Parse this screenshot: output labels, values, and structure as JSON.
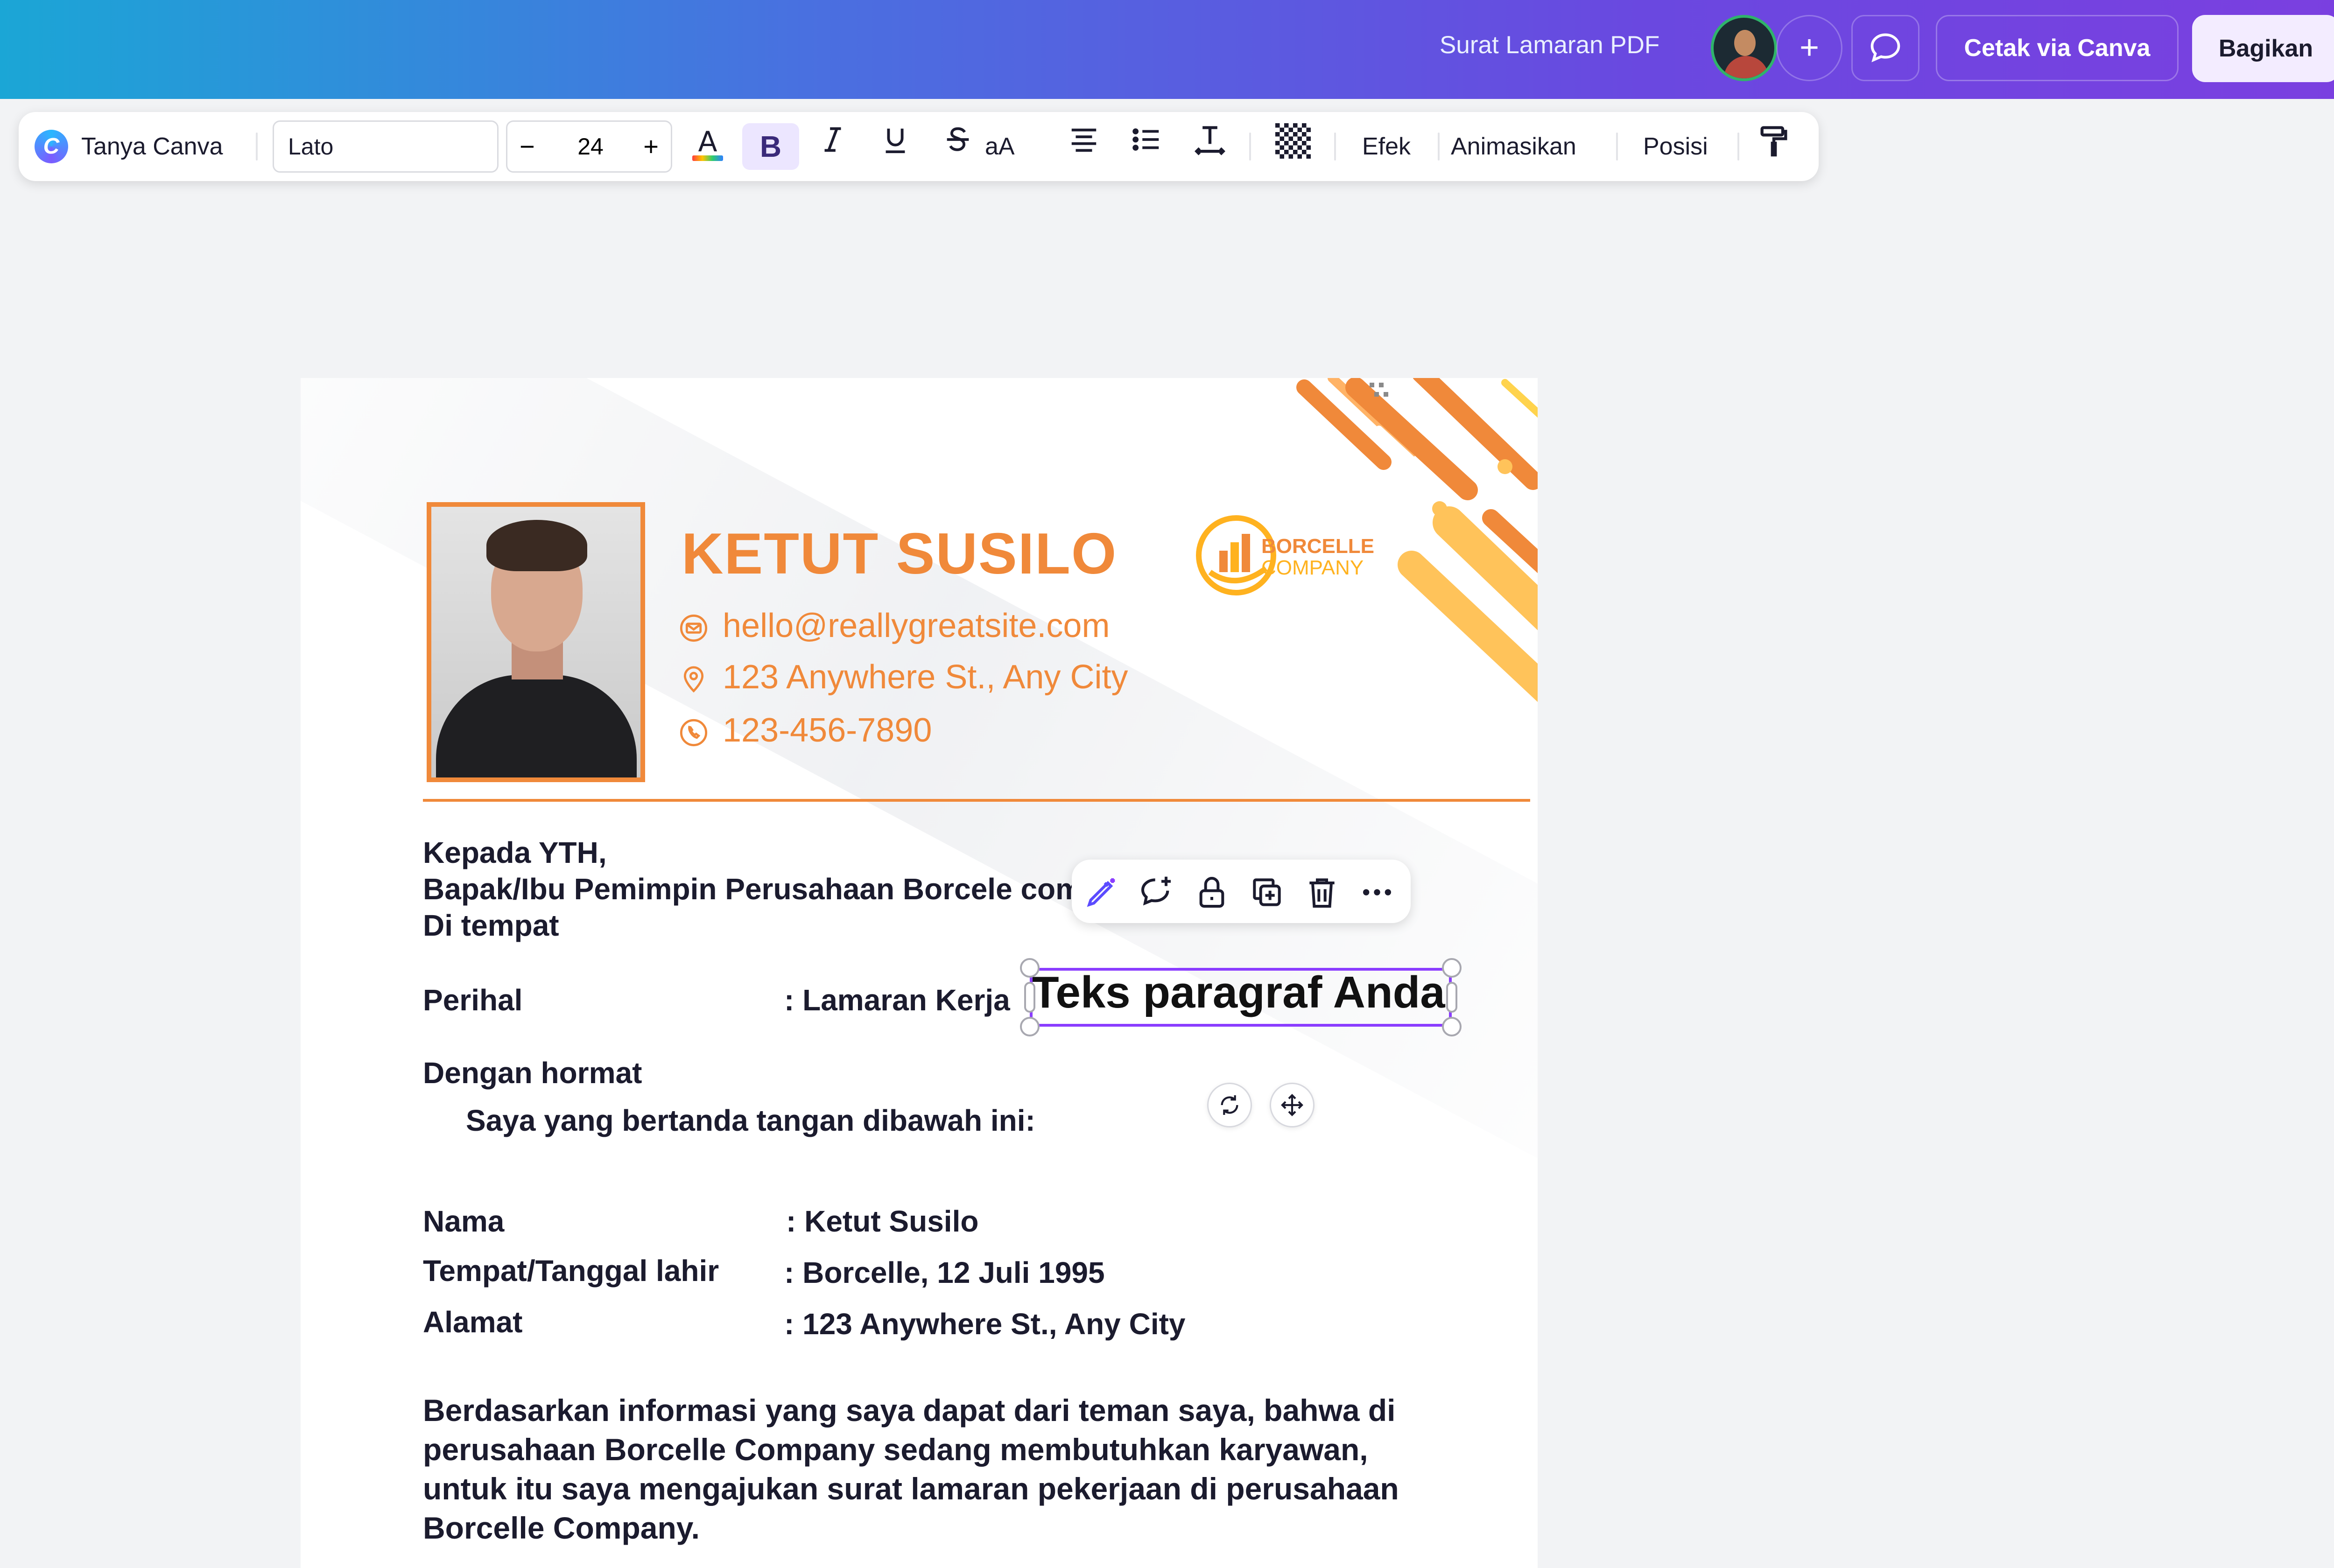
{
  "header": {
    "document_title": "Surat Lamaran PDF",
    "add_label": "+",
    "print_label": "Cetak via Canva",
    "share_label": "Bagikan"
  },
  "toolbar": {
    "assistant_label": "Tanya Canva",
    "font_name": "Lato",
    "font_size": "24",
    "decrease_label": "−",
    "increase_label": "+",
    "bold_label": "B",
    "case_label": "aA",
    "effects_label": "Efek",
    "animate_label": "Animasikan",
    "position_label": "Posisi"
  },
  "resume": {
    "name": "KETUT SUSILO",
    "email": "hello@reallygreatsite.com",
    "address": "123 Anywhere St., Any City",
    "phone": "123-456-7890",
    "logo_line1": "BORCELLE",
    "logo_line2": "COMPANY"
  },
  "letter": {
    "to_line1": "Kepada YTH,",
    "to_line2": "Bapak/Ibu Pemimpin Perusahaan Borcele com",
    "to_line3": "Di tempat",
    "subject_label": "Perihal",
    "subject_value": ": Lamaran Kerja",
    "greeting": "Dengan hormat",
    "intro": "Saya yang bertanda tangan dibawah ini:",
    "fields": [
      {
        "label": "Nama",
        "value": ": Ketut Susilo"
      },
      {
        "label": "Tempat/Tanggal lahir",
        "value": ": Borcelle, 12 Juli 1995"
      },
      {
        "label": "Alamat",
        "value": ": 123 Anywhere St., Any City"
      }
    ],
    "body_line1": "Berdasarkan informasi yang saya dapat dari teman saya, bahwa di",
    "body_line2": "perusahaan Borcelle Company sedang membutuhkan karyawan,",
    "body_line3": "untuk itu saya mengajukan surat lamaran pekerjaan di perusahaan",
    "body_line4": "Borcelle Company."
  },
  "selection": {
    "text": "Teks paragraf Anda"
  },
  "colors": {
    "accent_orange": "#f0893a",
    "selection_purple": "#8b3dff",
    "share_bg": "#f3ecff"
  }
}
